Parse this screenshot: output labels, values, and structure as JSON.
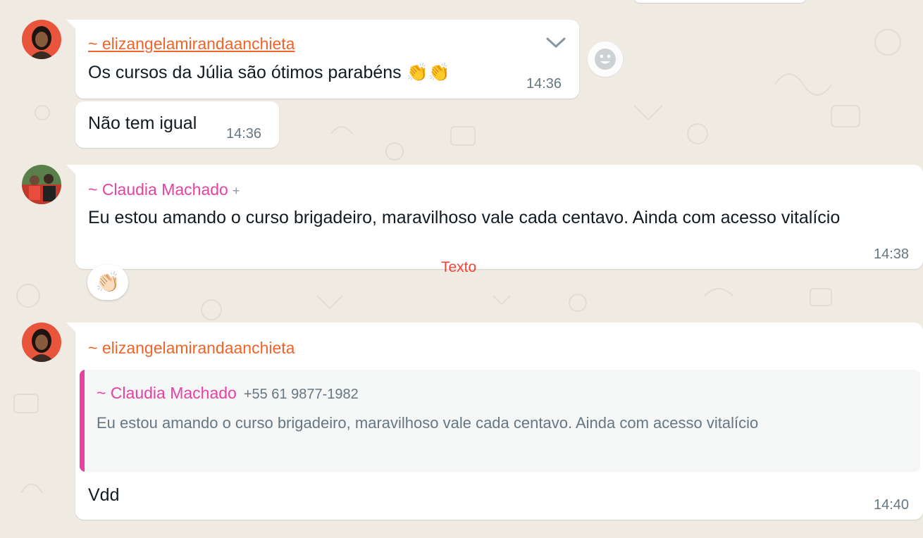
{
  "colors": {
    "background": "#efeae2",
    "bubble": "#ffffff",
    "sender_orange": "#f0642a",
    "sender_pink": "#e542a3",
    "meta_gray": "#667781",
    "annotation_red": "#f44336"
  },
  "messages": [
    {
      "sender": "~ elizangelamirandaanchieta",
      "text": "Os cursos da Júlia são ótimos parabéns 👏👏",
      "time": "14:36"
    },
    {
      "text": "Não tem igual",
      "time": "14:36"
    },
    {
      "sender": "~ Claudia Machado",
      "sender_extra": "+",
      "text": "Eu estou amando o curso brigadeiro, maravilhoso vale cada centavo. Ainda com acesso vitalício",
      "time": "14:38",
      "reaction": "👏🏻"
    },
    {
      "sender": "~ elizangelamirandaanchieta",
      "quoted": {
        "sender": "~ Claudia Machado",
        "phone": "+55 61 9877-1982",
        "text": "Eu estou amando o curso brigadeiro, maravilhoso vale cada centavo. Ainda com acesso vitalício"
      },
      "text": "Vdd",
      "time": "14:40"
    }
  ],
  "annotation": "Texto",
  "icons": {
    "menu": "chevron-down-icon",
    "react": "emoji-smiley-icon"
  }
}
